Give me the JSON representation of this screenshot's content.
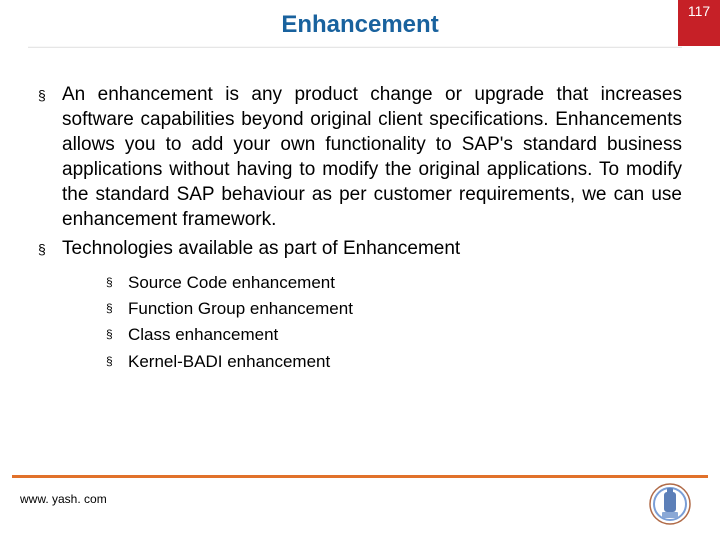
{
  "header": {
    "title": "Enhancement",
    "page_number": "117"
  },
  "bullets": {
    "level1": [
      "An enhancement is any product change or upgrade that increases software capabilities beyond original client specifications. Enhancements allows you to add your own functionality to SAP's standard business applications without having to modify the original applications. To modify the standard SAP behaviour as per customer requirements, we can use enhancement framework.",
      "Technologies available as part of Enhancement"
    ],
    "level2": [
      "Source Code enhancement",
      "Function Group enhancement",
      "Class enhancement",
      "Kernel-BADI enhancement"
    ]
  },
  "footer": {
    "url": "www. yash. com"
  },
  "colors": {
    "title": "#19629e",
    "pagebox": "#c62027",
    "rule": "#e1712a"
  }
}
